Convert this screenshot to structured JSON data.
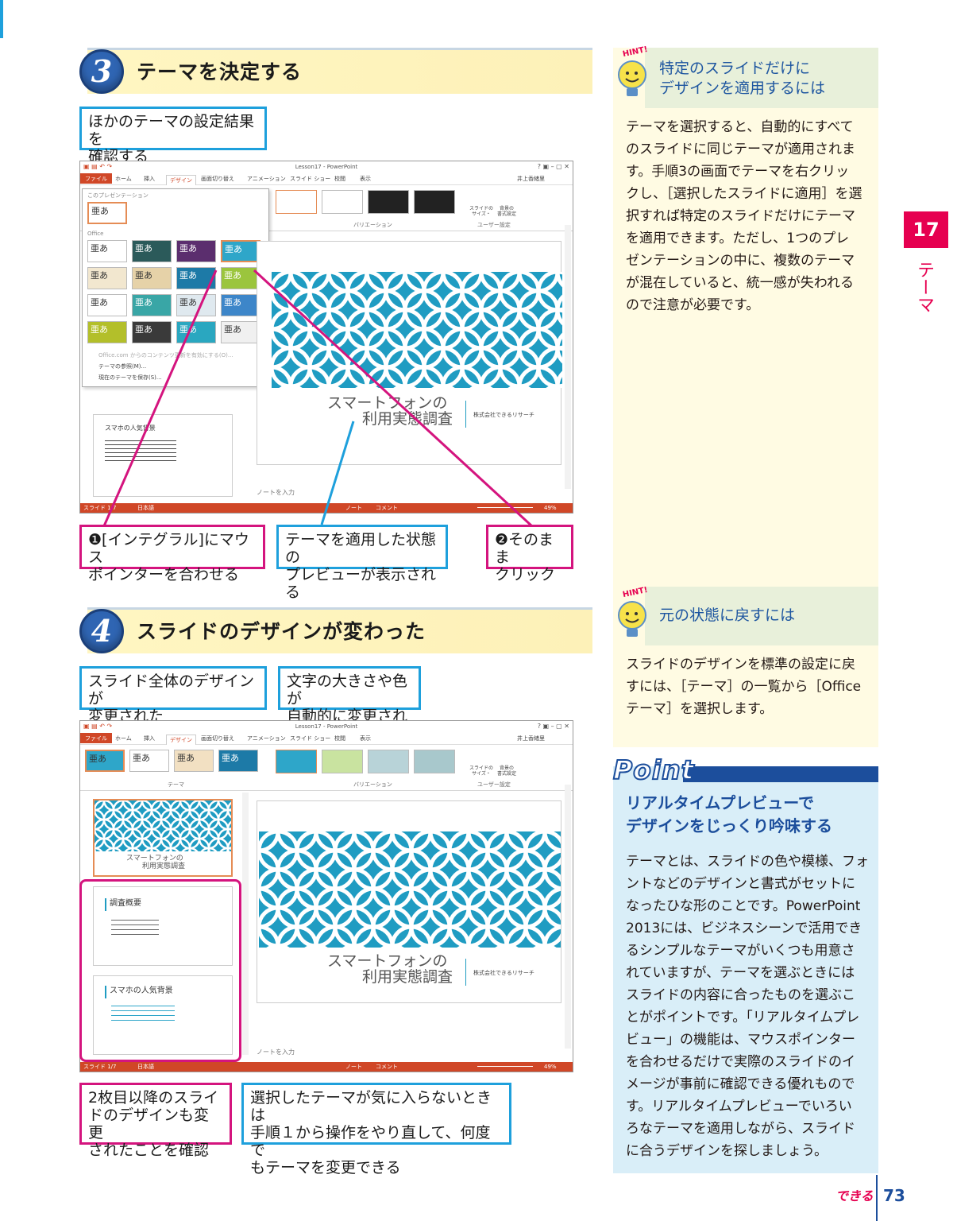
{
  "step3": {
    "number": "3",
    "title": "テーマを決定する",
    "callout_top": "ほかのテーマの設定結果を\n確認する",
    "callout_1": "❶[インテグラル]にマウス\nポインターを合わせる",
    "callout_2": "テーマを適用した状態の\nプレビューが表示される",
    "callout_3": "❷そのまま\nクリック"
  },
  "step4": {
    "number": "4",
    "title": "スライドのデザインが変わった",
    "callout_a": "スライド全体のデザインが\n変更された",
    "callout_b": "文字の大きさや色が\n自動的に変更される",
    "callout_c": "2枚目以降のスライ\nドのデザインも変更\nされたことを確認",
    "callout_d": "選択したテーマが気に入らないときは\n手順１から操作をやり直して、何度で\nもテーマを変更できる"
  },
  "app": {
    "window_title": "Lesson17 - PowerPoint",
    "tabs": [
      "ファイル",
      "ホーム",
      "挿入",
      "デザイン",
      "画面切り替え",
      "アニメーション",
      "スライド ショー",
      "校閲",
      "表示"
    ],
    "user": "井上香緒里",
    "group_variation": "バリエーション",
    "group_user": "ユーザー設定",
    "group_theme": "テーマ",
    "slide_size_label": "スライドの\nサイズ・",
    "bg_format_label": "背景の\n書式設定",
    "gallery_section_current": "このプレゼンテーション",
    "gallery_section_office": "Office",
    "thumb_text": "亜あ",
    "gallery_menu": [
      "Office.com からのコンテンツ更新を有効にする(O)...",
      "テーマの参照(M)...",
      "現在のテーマを保存(S)..."
    ],
    "slide_title_line1": "スマートフォンの",
    "slide_title_line2": "利用実態調査",
    "slide_company": "株式会社できるリサーチ",
    "notes_placeholder": "ノートを入力",
    "status_slide": "スライド 1/7",
    "status_lang": "日本語",
    "status_notes": "ノート",
    "status_comments": "コメント",
    "zoom": "49%",
    "slide2_title": "調査概要",
    "slide3_title": "スマホの人気背景"
  },
  "sidebar": {
    "chapter_number": "17",
    "chapter_label": "テーマ",
    "hint1_badge": "HINT!",
    "hint1_title": "特定のスライドだけに\nデザインを適用するには",
    "hint1_body": "テーマを選択すると、自動的にすべて\nのスライドに同じテーマが適用されま\nす。手順3の画面でテーマを右クリッ\nクし、［選択したスライドに適用］を選\n択すれば特定のスライドだけにテーマ\nを適用できます。ただし、1つのプレ\nゼンテーションの中に、複数のテーマ\nが混在していると、統一感が失われる\nので注意が必要です。",
    "hint2_badge": "HINT!",
    "hint2_title": "元の状態に戻すには",
    "hint2_body": "スライドのデザインを標準の設定に戻\nすには、［テーマ］の一覧から［Office\nテーマ］を選択します。",
    "point_label": "Point",
    "point_title": "リアルタイムプレビューで\nデザインをじっくり吟味する",
    "point_body": "テーマとは、スライドの色や模様、フォ\nントなどのデザインと書式がセットに\nなったひな形のことです。PowerPoint\n2013には、ビジネスシーンで活用でき\nるシンプルなテーマがいくつも用意さ\nれていますが、テーマを選ぶときには\nスライドの内容に合ったものを選ぶこ\nとがポイントです。「リアルタイムプレ\nビュー」の機能は、マウスポインター\nを合わせるだけで実際のスライドのイ\nメージが事前に確認できる優れもので\nす。リアルタイムプレビューでいろい\nろなテーマを適用しながら、スライド\nに合うデザインを探しましょう。"
  },
  "footer": {
    "brand": "できる",
    "page_number": "73"
  },
  "colors": {
    "accent_pink": "#d4147e",
    "accent_blue": "#1ea0dc",
    "chapter_red": "#e60050",
    "ppt_orange": "#d04727",
    "theme_teal": "#1f9cc2"
  }
}
